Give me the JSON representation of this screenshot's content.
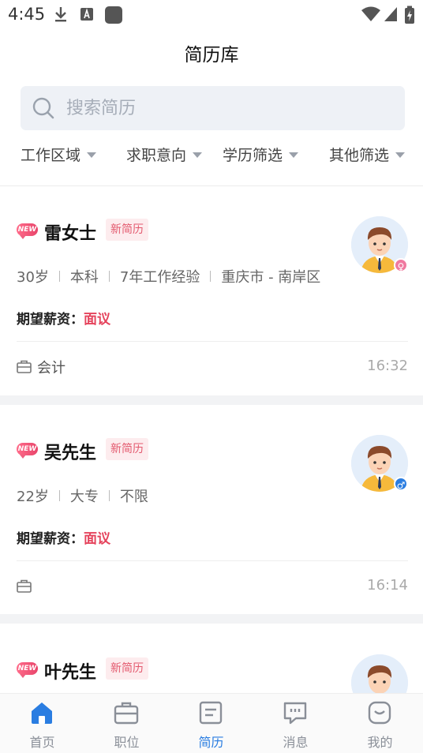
{
  "status_bar": {
    "time": "4:45"
  },
  "header": {
    "title": "简历库"
  },
  "search": {
    "placeholder": "搜索简历"
  },
  "filters": [
    {
      "label": "工作区域"
    },
    {
      "label": "求职意向"
    },
    {
      "label": "学历筛选"
    },
    {
      "label": "其他筛选"
    }
  ],
  "resumes": [
    {
      "badge": "NEW",
      "name": "雷女士",
      "tag": "新简历",
      "meta": [
        "30岁",
        "本科",
        "7年工作经验",
        "重庆市 - 南岸区"
      ],
      "salary_label": "期望薪资：",
      "salary_value": "面议",
      "job_title": "会计",
      "time": "16:32",
      "gender": "female",
      "gender_symbol": "♀"
    },
    {
      "badge": "NEW",
      "name": "吴先生",
      "tag": "新简历",
      "meta": [
        "22岁",
        "大专",
        "不限"
      ],
      "salary_label": "期望薪资：",
      "salary_value": "面议",
      "job_title": "",
      "time": "16:14",
      "gender": "male",
      "gender_symbol": "♂"
    },
    {
      "badge": "NEW",
      "name": "叶先生",
      "tag": "新简历"
    }
  ],
  "tabs": [
    {
      "label": "首页",
      "icon": "home-icon"
    },
    {
      "label": "职位",
      "icon": "briefcase-icon"
    },
    {
      "label": "简历",
      "icon": "resume-icon",
      "active": true
    },
    {
      "label": "消息",
      "icon": "message-icon"
    },
    {
      "label": "我的",
      "icon": "profile-icon"
    }
  ],
  "colors": {
    "accent": "#2a7de1",
    "salary": "#e5435c",
    "tag_bg": "#fdecee"
  }
}
